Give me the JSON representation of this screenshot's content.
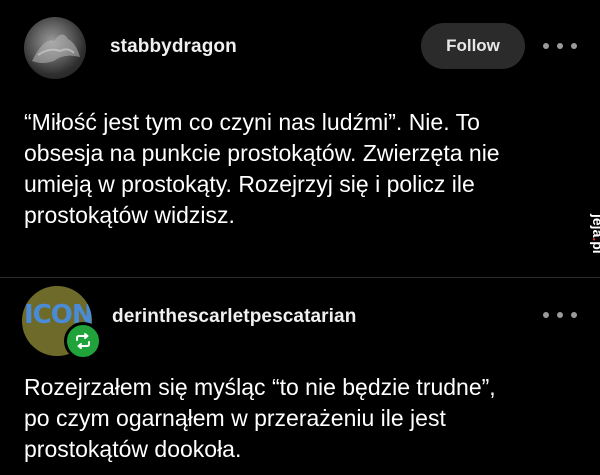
{
  "post1": {
    "username": "stabbydragon",
    "follow_label": "Follow",
    "text": "“Miłość jest tym co czyni nas ludźmi”. Nie. To\nobsesja na punkcie prostokątów. Zwierzęta nie\numieją w prostokąty. Rozejrzyj się i policz ile\nprostokątów widzisz."
  },
  "post2": {
    "username": "derinthescarletpescatarian",
    "avatar_text": "ICON",
    "text": "Rozejrzałem się myśląc “to nie będzie trudne”,\npo czym ogarnąłem w przerażeniu ile jest\nprostokątów dookoła."
  },
  "watermark": "jeja.pl",
  "icons": [
    "more-options-icon",
    "reblog-icon"
  ],
  "colors": {
    "background": "#000000",
    "follow_button": "#2b2b2b",
    "reblog_green": "#21a33c",
    "watermark_red": "#e0322b"
  }
}
